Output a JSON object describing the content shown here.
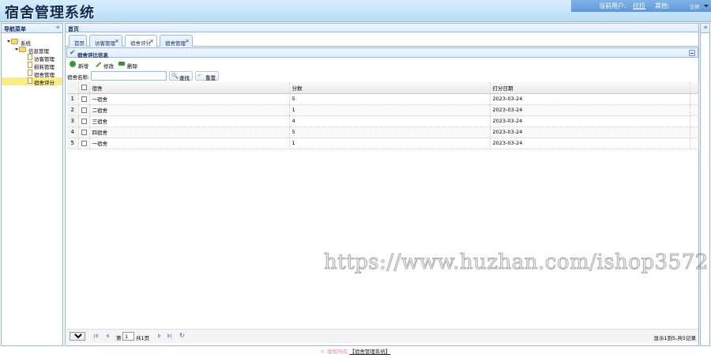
{
  "header": {
    "app_title": "宿舍管理系统",
    "current_user_label": "当前用户:",
    "current_user_name": "拉拉",
    "other_label": "其他:",
    "other_value": "注销"
  },
  "west": {
    "title": "导航菜单",
    "collapse_glyph": "«",
    "tree": [
      {
        "label": "系统",
        "level": 0,
        "type": "folder",
        "expanded": true
      },
      {
        "label": "信息管理",
        "level": 1,
        "type": "folder",
        "expanded": true
      },
      {
        "label": "访客管理",
        "level": 2,
        "type": "file"
      },
      {
        "label": "损耗管理",
        "level": 2,
        "type": "file"
      },
      {
        "label": "宿舍管理",
        "level": 2,
        "type": "file"
      },
      {
        "label": "宿舍评分",
        "level": 2,
        "type": "file",
        "selected": true
      }
    ]
  },
  "center": {
    "title": "首页",
    "east_collapse_glyph": "«"
  },
  "tabs": [
    {
      "label": "首页",
      "closable": false
    },
    {
      "label": "访客管理",
      "closable": true
    },
    {
      "label": "宿舍评分",
      "closable": true,
      "active": true
    },
    {
      "label": "宿舍管理",
      "closable": true
    }
  ],
  "grid_panel": {
    "title": "宿舍评比信息",
    "toolbar": {
      "add_label": "新增",
      "edit_label": "修改",
      "delete_label": "删除"
    },
    "search": {
      "label": "宿舍名称:",
      "value": "",
      "search_button": "查找",
      "reset_button": "重置"
    },
    "columns": [
      "宿舍",
      "分数",
      "打分日期"
    ],
    "rows": [
      {
        "num": "1",
        "dorm": "一宿舍",
        "score": "5",
        "date": "2023-03-24"
      },
      {
        "num": "2",
        "dorm": "二宿舍",
        "score": "1",
        "date": "2023-03-24"
      },
      {
        "num": "3",
        "dorm": "三宿舍",
        "score": "4",
        "date": "2023-03-24"
      },
      {
        "num": "4",
        "dorm": "四宿舍",
        "score": "5",
        "date": "2023-03-24"
      },
      {
        "num": "5",
        "dorm": "一宿舍",
        "score": "1",
        "date": "2023-03-24"
      }
    ],
    "pager": {
      "page_size": "5",
      "page_prefix": "第",
      "page_number": "1",
      "page_suffix": "共1页",
      "info": "显示1到5,共5记录"
    }
  },
  "watermark": "https://www.huzhan.com/ishop3572",
  "footer": {
    "copyright": "© 版权所有",
    "link": "【宿舍管理系统】"
  },
  "colors": {
    "border": "#95b8e7",
    "header_bg": "#c6e4f8",
    "selected_node": "#fbec88",
    "title": "#0d2a54"
  }
}
